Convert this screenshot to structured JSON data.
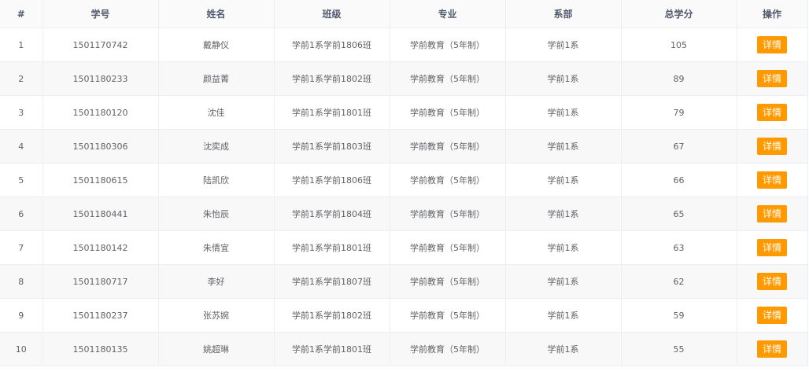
{
  "table": {
    "headers": {
      "index": "#",
      "student_id": "学号",
      "name": "姓名",
      "class": "班级",
      "major": "专业",
      "department": "系部",
      "total_credits": "总学分",
      "action": "操作"
    },
    "detail_label": "详情",
    "accent_color": "#ff9900",
    "rows": [
      {
        "index": "1",
        "student_id": "1501170742",
        "name": "戴静仪",
        "class": "学前1系学前1806班",
        "major": "学前教育（5年制）",
        "department": "学前1系",
        "total_credits": "105"
      },
      {
        "index": "2",
        "student_id": "1501180233",
        "name": "颜益菁",
        "class": "学前1系学前1802班",
        "major": "学前教育（5年制）",
        "department": "学前1系",
        "total_credits": "89"
      },
      {
        "index": "3",
        "student_id": "1501180120",
        "name": "沈佳",
        "class": "学前1系学前1801班",
        "major": "学前教育（5年制）",
        "department": "学前1系",
        "total_credits": "79"
      },
      {
        "index": "4",
        "student_id": "1501180306",
        "name": "沈奕成",
        "class": "学前1系学前1803班",
        "major": "学前教育（5年制）",
        "department": "学前1系",
        "total_credits": "67"
      },
      {
        "index": "5",
        "student_id": "1501180615",
        "name": "陆凯欣",
        "class": "学前1系学前1806班",
        "major": "学前教育（5年制）",
        "department": "学前1系",
        "total_credits": "66"
      },
      {
        "index": "6",
        "student_id": "1501180441",
        "name": "朱怡辰",
        "class": "学前1系学前1804班",
        "major": "学前教育（5年制）",
        "department": "学前1系",
        "total_credits": "65"
      },
      {
        "index": "7",
        "student_id": "1501180142",
        "name": "朱倩宜",
        "class": "学前1系学前1801班",
        "major": "学前教育（5年制）",
        "department": "学前1系",
        "total_credits": "63"
      },
      {
        "index": "8",
        "student_id": "1501180717",
        "name": "李好",
        "class": "学前1系学前1807班",
        "major": "学前教育（5年制）",
        "department": "学前1系",
        "total_credits": "62"
      },
      {
        "index": "9",
        "student_id": "1501180237",
        "name": "张苏婉",
        "class": "学前1系学前1802班",
        "major": "学前教育（5年制）",
        "department": "学前1系",
        "total_credits": "59"
      },
      {
        "index": "10",
        "student_id": "1501180135",
        "name": "姚超琳",
        "class": "学前1系学前1801班",
        "major": "学前教育（5年制）",
        "department": "学前1系",
        "total_credits": "55"
      }
    ]
  }
}
